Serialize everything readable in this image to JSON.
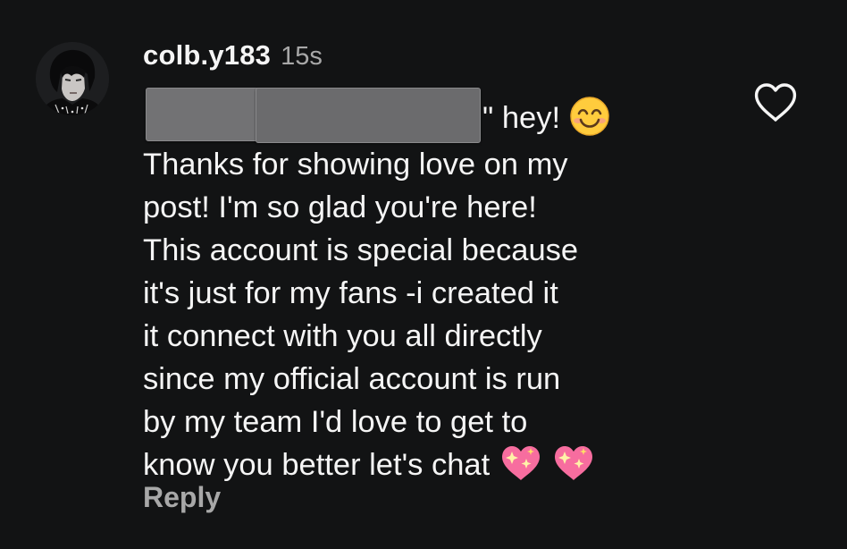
{
  "comment": {
    "username": "colb.y183",
    "timestamp": "15s",
    "lines": [
      "\" hey!",
      "Thanks for showing love on my",
      "post! I'm so glad you're here!",
      "This account is special because",
      "it's just for my fans -i created it",
      "it connect with you all directly",
      "since my official account is run",
      "by my team I'd love to get to",
      "know you better let's chat"
    ],
    "reply_label": "Reply",
    "like_icon": "heart-outline-icon",
    "emojis": [
      "smiling-face-icon",
      "sparkling-heart-icon",
      "sparkling-heart-icon"
    ]
  },
  "colors": {
    "background": "#121314",
    "text": "#f5f5f5",
    "secondary_text": "#a8a8a8",
    "redaction": "#6f6f71",
    "heart_pink": "#f76d9f"
  }
}
